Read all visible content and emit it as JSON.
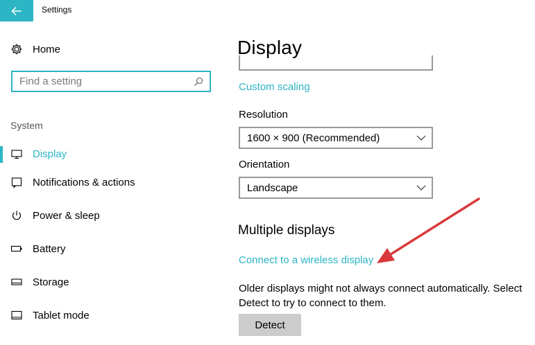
{
  "window": {
    "title": "Settings"
  },
  "sidebar": {
    "home_label": "Home",
    "search": {
      "placeholder": "Find a setting",
      "value": ""
    },
    "section_label": "System",
    "items": [
      {
        "label": "Display",
        "icon": "monitor-icon",
        "active": true
      },
      {
        "label": "Notifications & actions",
        "icon": "notification-icon",
        "active": false
      },
      {
        "label": "Power & sleep",
        "icon": "power-icon",
        "active": false
      },
      {
        "label": "Battery",
        "icon": "battery-icon",
        "active": false
      },
      {
        "label": "Storage",
        "icon": "storage-icon",
        "active": false
      },
      {
        "label": "Tablet mode",
        "icon": "tablet-icon",
        "active": false
      }
    ]
  },
  "main": {
    "title": "Display",
    "custom_scaling_link": "Custom scaling",
    "resolution": {
      "label": "Resolution",
      "value": "1600 × 900 (Recommended)"
    },
    "orientation": {
      "label": "Orientation",
      "value": "Landscape"
    },
    "multiple_displays": {
      "heading": "Multiple displays",
      "wireless_link": "Connect to a wireless display",
      "note": "Older displays might not always connect automatically. Select Detect to try to connect to them.",
      "detect_button": "Detect"
    }
  },
  "colors": {
    "accent": "#2cb5c4",
    "annotation_arrow": "#d9393b",
    "button_bg": "#cccccc"
  }
}
